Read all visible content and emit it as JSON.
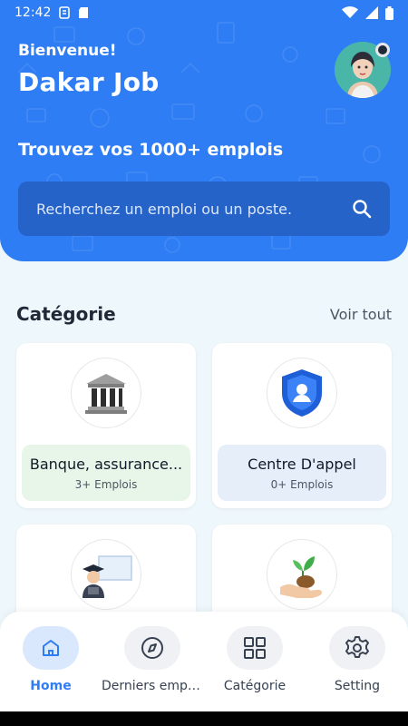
{
  "status_bar": {
    "time": "12:42"
  },
  "header": {
    "greeting": "Bienvenue!",
    "app_title": "Dakar Job",
    "tagline": "Trouvez vos 1000+ emplois",
    "search_placeholder": "Recherchez un emploi ou un poste."
  },
  "category_section": {
    "title": "Catégorie",
    "see_all": "Voir tout"
  },
  "categories": [
    {
      "name": "Banque, assurance...",
      "count": "3+ Emplois",
      "icon": "bank-icon",
      "bg": "#e8f6ea"
    },
    {
      "name": "Centre D'appel",
      "count": "0+ Emplois",
      "icon": "shield-user-icon",
      "bg": "#e6eef9"
    },
    {
      "name": "",
      "count": "",
      "icon": "teacher-icon",
      "bg": "#ffffff"
    },
    {
      "name": "",
      "count": "",
      "icon": "plant-hand-icon",
      "bg": "#ffffff"
    }
  ],
  "bottom_nav": [
    {
      "label": "Home",
      "icon": "home-icon",
      "active": true
    },
    {
      "label": "Derniers emplois",
      "icon": "compass-icon",
      "active": false
    },
    {
      "label": "Catégorie",
      "icon": "grid-icon",
      "active": false
    },
    {
      "label": "Setting",
      "icon": "gear-icon",
      "active": false
    }
  ],
  "colors": {
    "primary": "#2f7df4",
    "search_bg": "#2563c9",
    "background": "#eef7fb"
  }
}
